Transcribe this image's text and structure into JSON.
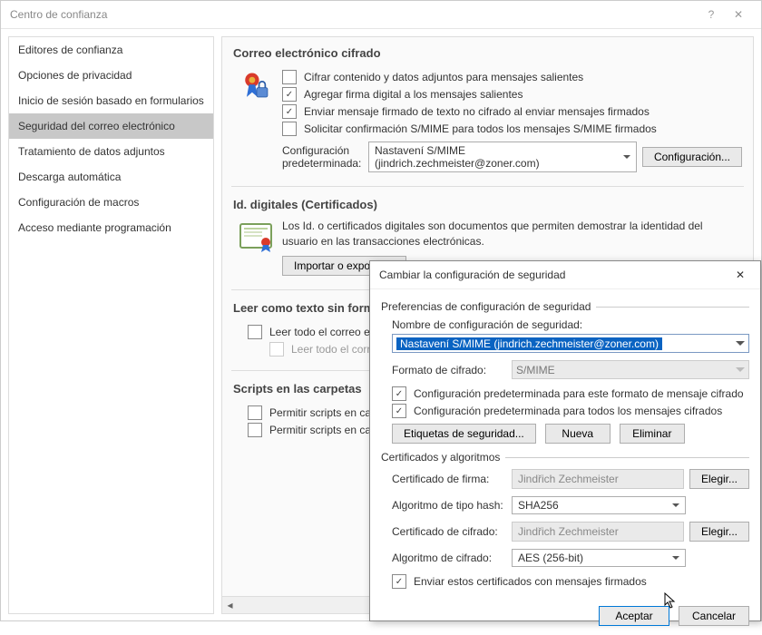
{
  "window": {
    "title": "Centro de confianza",
    "help": "?",
    "close": "✕"
  },
  "sidebar": {
    "items": [
      "Editores de confianza",
      "Opciones de privacidad",
      "Inicio de sesión basado en formularios",
      "Seguridad del correo electrónico",
      "Tratamiento de datos adjuntos",
      "Descarga automática",
      "Configuración de macros",
      "Acceso mediante programación"
    ],
    "selected_index": 3
  },
  "main": {
    "group_encrypted": "Correo electrónico cifrado",
    "opts": [
      {
        "label": "Cifrar contenido y datos adjuntos para mensajes salientes",
        "checked": false
      },
      {
        "label": "Agregar firma digital a los mensajes salientes",
        "checked": true
      },
      {
        "label": "Enviar mensaje firmado de texto no cifrado al enviar mensajes firmados",
        "checked": true
      },
      {
        "label": "Solicitar confirmación S/MIME para todos los mensajes S/MIME firmados",
        "checked": false
      }
    ],
    "default_label": "Configuración\npredeterminada:",
    "default_value": "Nastavení S/MIME (jindrich.zechmeister@zoner.com)",
    "config_btn": "Configuración...",
    "group_ids": "Id. digitales (Certificados)",
    "ids_desc": "Los Id. o certificados digitales son documentos que permiten demostrar la identidad del usuario en las transacciones electrónicas.",
    "import_btn": "Importar o exportar...",
    "group_plain": "Leer como texto sin formato",
    "plain_opts": [
      {
        "label": "Leer todo el correo estándar en texto sin formato",
        "checked": false,
        "disabled": false
      },
      {
        "label": "Leer todo el correo firmado digitalmente en texto sin formato",
        "checked": false,
        "disabled": true
      }
    ],
    "group_scripts": "Scripts en las carpetas",
    "script_opts": [
      {
        "label": "Permitir scripts en carpetas compartidas",
        "checked": false
      },
      {
        "label": "Permitir scripts en carpetas públicas",
        "checked": false
      }
    ]
  },
  "modal": {
    "title": "Cambiar la configuración de seguridad",
    "close": "✕",
    "prefs_title": "Preferencias de configuración de seguridad",
    "name_label": "Nombre de configuración de seguridad:",
    "name_value": "Nastavení S/MIME (jindrich.zechmeister@zoner.com)",
    "format_label": "Formato de cifrado:",
    "format_value": "S/MIME",
    "cb_default_format": "Configuración predeterminada para este formato de mensaje cifrado",
    "cb_default_all": "Configuración predeterminada para todos los mensajes cifrados",
    "btn_labels": "Etiquetas de seguridad...",
    "btn_new": "Nueva",
    "btn_delete": "Eliminar",
    "certs_title": "Certificados y algoritmos",
    "sign_cert_label": "Certificado de firma:",
    "sign_cert_value": "Jindřich Zechmeister",
    "hash_label": "Algoritmo de tipo hash:",
    "hash_value": "SHA256",
    "enc_cert_label": "Certificado de cifrado:",
    "enc_cert_value": "Jindřich Zechmeister",
    "enc_alg_label": "Algoritmo de cifrado:",
    "enc_alg_value": "AES (256-bit)",
    "send_certs": "Enviar estos certificados con mensajes firmados",
    "choose_btn": "Elegir...",
    "ok": "Aceptar",
    "cancel": "Cancelar"
  }
}
